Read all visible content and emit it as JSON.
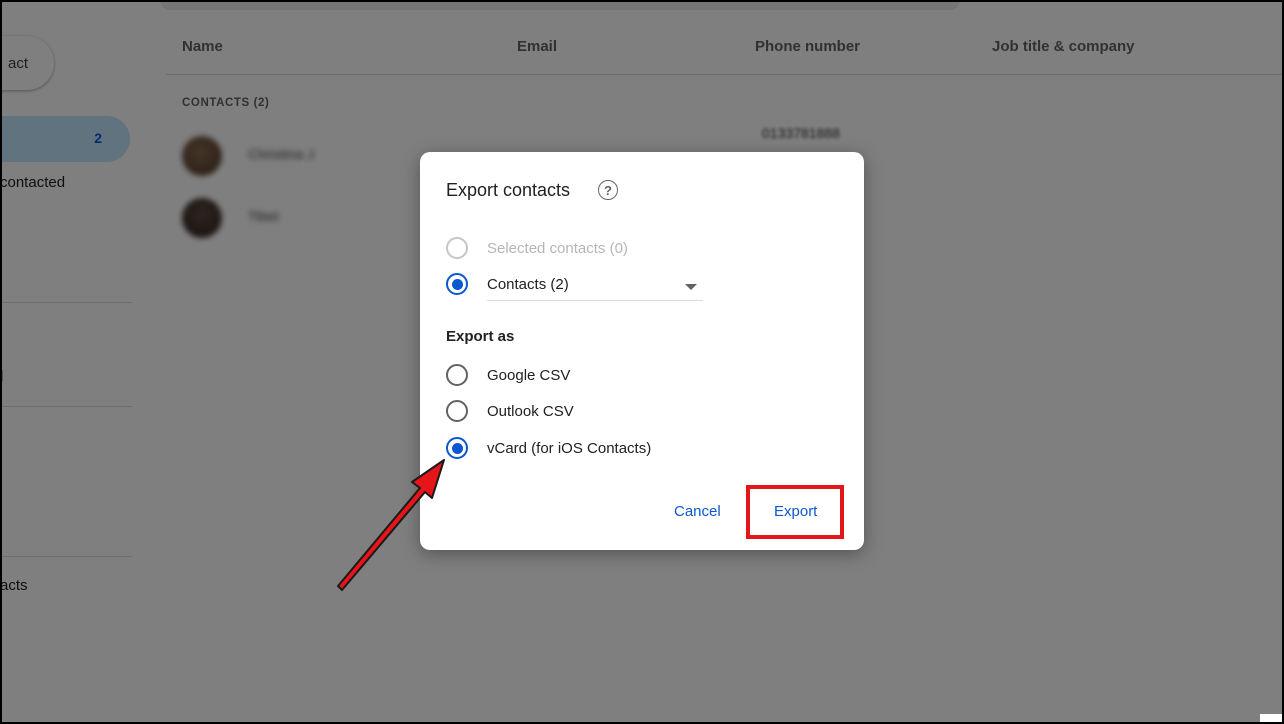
{
  "sidebar": {
    "create_button_label": "act",
    "contacts_count": "2",
    "item_contacted": "contacted",
    "item_l": "l",
    "item_acts": "acts"
  },
  "table": {
    "columns": [
      "Name",
      "Email",
      "Phone number",
      "Job title & company"
    ],
    "section_label": "CONTACTS (2)",
    "rows": [
      {
        "name": "Christina J",
        "phone": "0133781888"
      },
      {
        "name": "Tibet",
        "phone": ""
      }
    ]
  },
  "dialog": {
    "title": "Export contacts",
    "help_icon": "help-circle-icon",
    "scope_options": [
      {
        "label": "Selected contacts (0)",
        "state": "disabled"
      },
      {
        "label": "Contacts (2)",
        "state": "checked"
      }
    ],
    "export_as_title": "Export as",
    "format_options": [
      {
        "label": "Google CSV",
        "state": "unchecked"
      },
      {
        "label": "Outlook CSV",
        "state": "unchecked"
      },
      {
        "label": "vCard (for iOS Contacts)",
        "state": "checked"
      }
    ],
    "cancel_label": "Cancel",
    "export_label": "Export"
  },
  "colors": {
    "accent": "#0b57d0",
    "annotation_red": "#e6151a",
    "scrim": "rgba(0,0,0,0.5)"
  }
}
